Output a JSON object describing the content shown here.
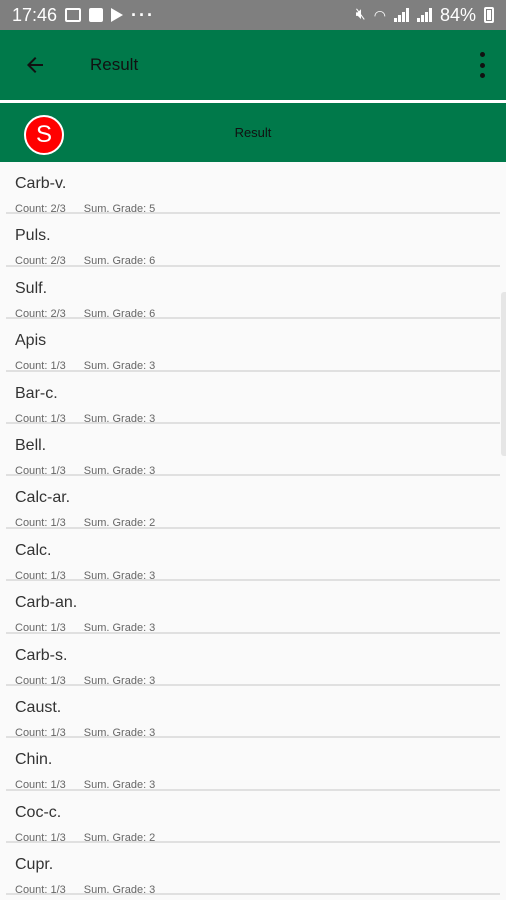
{
  "status_bar": {
    "time": "17:46",
    "battery": "84%",
    "icons": [
      "image-icon",
      "save-icon",
      "play-icon",
      "more-dots-icon",
      "mute-icon",
      "wifi-icon",
      "signal-icon",
      "signal-icon",
      "battery-icon"
    ]
  },
  "app_bar": {
    "title": "Result",
    "back_icon": "arrow-left-icon",
    "menu_icon": "more-vert-icon",
    "color": "#00794a"
  },
  "sub_header": {
    "badge_letter": "S",
    "badge_color": "#ff0000",
    "title": "Result"
  },
  "list": {
    "items": [
      {
        "name": "Carb-v.",
        "count": "Count: 2/3",
        "grade": "Sum. Grade: 5"
      },
      {
        "name": "Puls.",
        "count": "Count: 2/3",
        "grade": "Sum. Grade: 6"
      },
      {
        "name": "Sulf.",
        "count": "Count: 2/3",
        "grade": "Sum. Grade: 6"
      },
      {
        "name": "Apis",
        "count": "Count: 1/3",
        "grade": "Sum. Grade: 3"
      },
      {
        "name": "Bar-c.",
        "count": "Count: 1/3",
        "grade": "Sum. Grade: 3"
      },
      {
        "name": "Bell.",
        "count": "Count: 1/3",
        "grade": "Sum. Grade: 3"
      },
      {
        "name": "Calc-ar.",
        "count": "Count: 1/3",
        "grade": "Sum. Grade: 2"
      },
      {
        "name": "Calc.",
        "count": "Count: 1/3",
        "grade": "Sum. Grade: 3"
      },
      {
        "name": "Carb-an.",
        "count": "Count: 1/3",
        "grade": "Sum. Grade: 3"
      },
      {
        "name": "Carb-s.",
        "count": "Count: 1/3",
        "grade": "Sum. Grade: 3"
      },
      {
        "name": "Caust.",
        "count": "Count: 1/3",
        "grade": "Sum. Grade: 3"
      },
      {
        "name": "Chin.",
        "count": "Count: 1/3",
        "grade": "Sum. Grade: 3"
      },
      {
        "name": "Coc-c.",
        "count": "Count: 1/3",
        "grade": "Sum. Grade: 2"
      },
      {
        "name": "Cupr.",
        "count": "Count: 1/3",
        "grade": "Sum. Grade: 3"
      }
    ]
  }
}
